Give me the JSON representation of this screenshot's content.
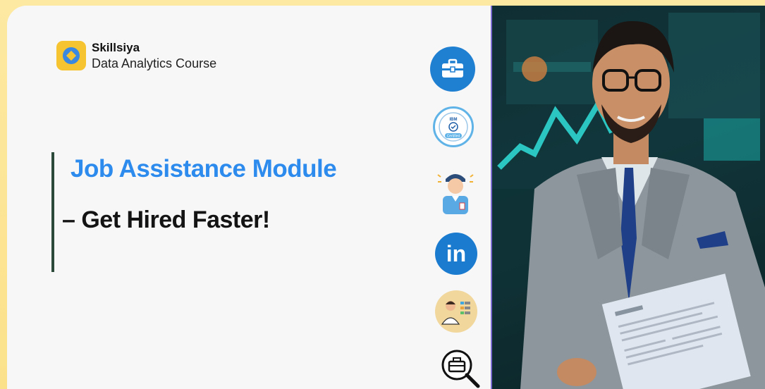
{
  "brand": {
    "name": "Skillsiya",
    "course": "Data Analytics Course"
  },
  "headline": {
    "title": "Job Assistance Module",
    "subtitle": "– Get Hired Faster!"
  },
  "icons": [
    {
      "name": "briefcase-icon"
    },
    {
      "name": "ibm-certified-badge-icon",
      "label": "Certified",
      "top_text": "IBM"
    },
    {
      "name": "professional-person-icon"
    },
    {
      "name": "linkedin-icon",
      "label": "in"
    },
    {
      "name": "candidate-profile-icon"
    },
    {
      "name": "job-search-icon"
    }
  ],
  "colors": {
    "accent_blue": "#2d8bee",
    "background": "#f7f7f8",
    "frame_yellow": "#fde9a0",
    "linkedin_blue": "#1a7bcf"
  }
}
